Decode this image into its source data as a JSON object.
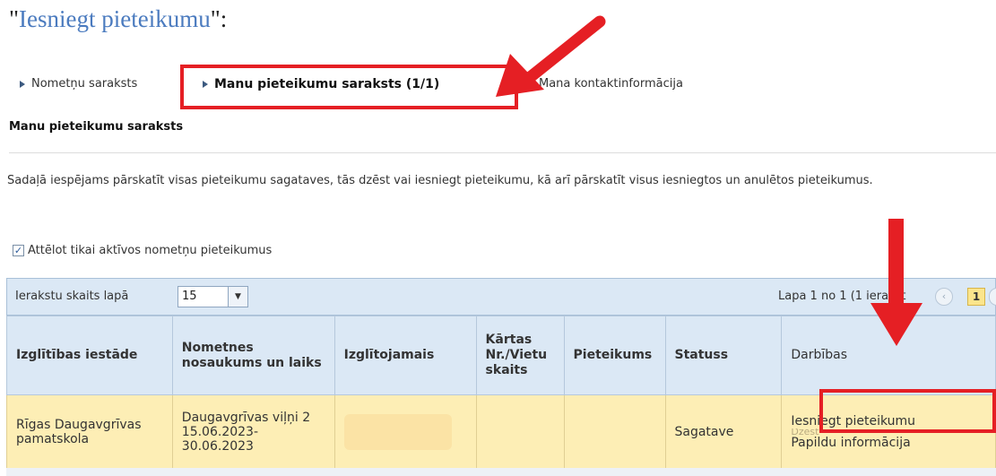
{
  "heading": {
    "quote_open": "\"",
    "link": "Iesniegt pieteikumu",
    "quote_close": "\":"
  },
  "tabs": [
    {
      "label": "Nometņu saraksts"
    },
    {
      "label": "Manu pieteikumu saraksts (1/1)"
    },
    {
      "label": "Mana kontaktinformācija"
    }
  ],
  "section_title": "Manu pieteikumu saraksts",
  "description": "Sadaļā iespējams pārskatīt visas pieteikumu sagataves, tās dzēst vai iesniegt pieteikumu, kā arī pārskatīt visus iesniegtos un anulētos pieteikumus.",
  "filter": {
    "label": "Attēlot tikai aktīvos nometņu pieteikumus",
    "checked": true
  },
  "toolbar": {
    "page_size_label": "Ierakstu skaits lapā",
    "page_size_value": "15",
    "pager_text": "Lapa 1 no 1 (1 ierakst",
    "current_page": "1"
  },
  "table": {
    "headers": [
      "Izglītības iestāde",
      "Nometnes nosaukums un laiks",
      "Izglītojamais",
      "Kārtas Nr./Vietu skaits",
      "Pieteikums",
      "Statuss",
      "Darbības"
    ],
    "row": {
      "institution": "Rīgas Daugavgrīvas pamatskola",
      "camp": "Daugavgrīvas viļņi 2 15.06.2023-30.06.2023",
      "student": "",
      "order_seats": "",
      "application": "",
      "status": "Sagatave",
      "actions": [
        "Iesniegt pieteikumu",
        "Dzēst",
        "Papildu informācija"
      ]
    }
  },
  "colors": {
    "highlight": "#e51f24",
    "header_bg": "#dbe8f5",
    "row_bg": "#fdeeb5",
    "link": "#4b7bbf"
  }
}
